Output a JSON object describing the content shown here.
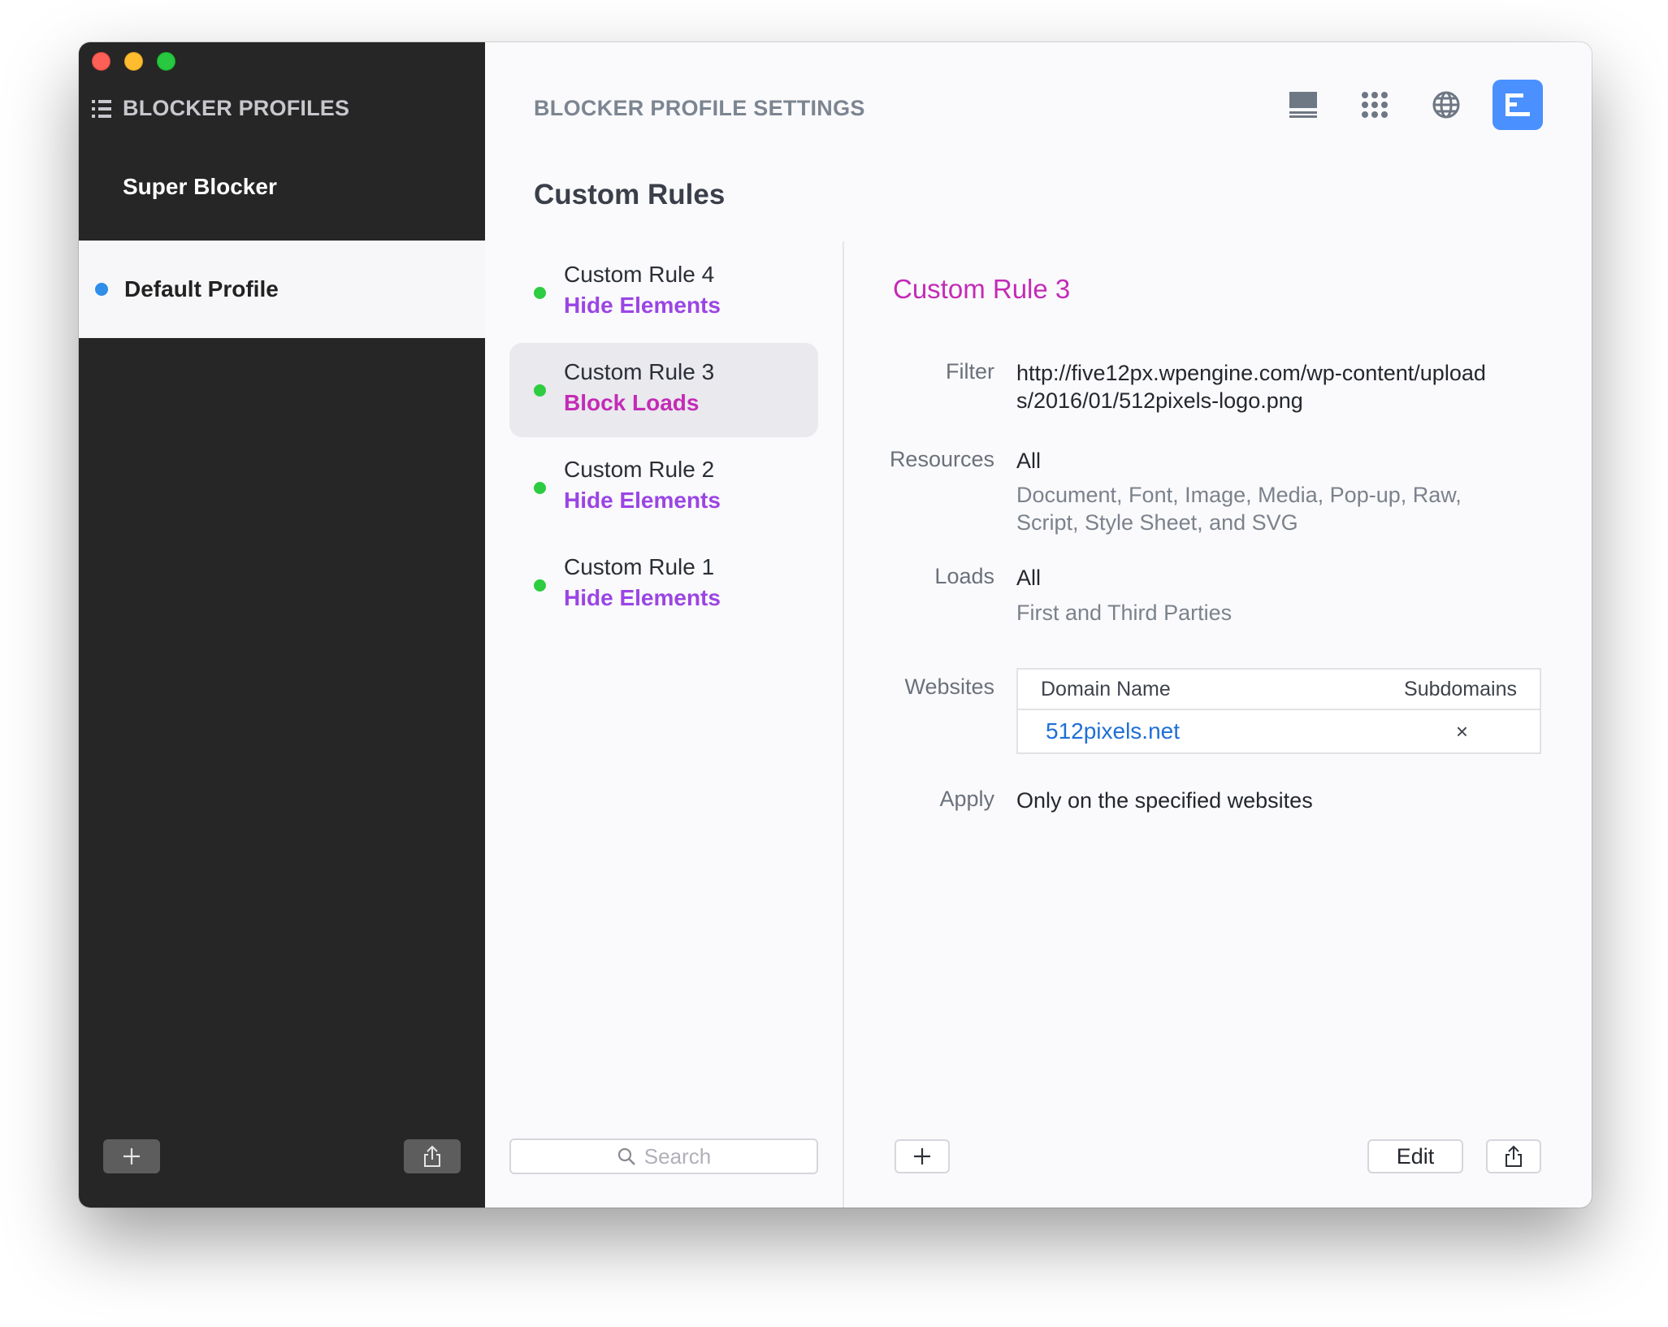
{
  "sidebar": {
    "title": "BLOCKER PROFILES",
    "profiles": [
      {
        "label": "Super Blocker"
      },
      {
        "label": "Default Profile"
      }
    ]
  },
  "main": {
    "title": "BLOCKER PROFILE SETTINGS",
    "section_title": "Custom Rules",
    "toolbar_icons": [
      "list-view-icon",
      "grid-view-icon",
      "globe-icon",
      "custom-rules-icon"
    ]
  },
  "rules": [
    {
      "name": "Custom Rule 4",
      "action": "Hide Elements"
    },
    {
      "name": "Custom Rule 3",
      "action": "Block Loads"
    },
    {
      "name": "Custom Rule 2",
      "action": "Hide Elements"
    },
    {
      "name": "Custom Rule 1",
      "action": "Hide Elements"
    }
  ],
  "search": {
    "placeholder": "Search"
  },
  "detail": {
    "title": "Custom Rule 3",
    "filter_label": "Filter",
    "filter_value_line1": "http://five12px.wpengine.com/wp-content/upload",
    "filter_value_line2": "s/2016/01/512pixels-logo.png",
    "resources_label": "Resources",
    "resources_value": "All",
    "resources_detail_line1": "Document, Font, Image, Media, Pop-up, Raw,",
    "resources_detail_line2": "Script, Style Sheet, and SVG",
    "loads_label": "Loads",
    "loads_value": "All",
    "loads_detail": "First and Third Parties",
    "websites_label": "Websites",
    "websites_columns": [
      "Domain Name",
      "Subdomains"
    ],
    "websites": [
      {
        "domain": "512pixels.net",
        "subdomains": "×"
      }
    ],
    "apply_label": "Apply",
    "apply_value": "Only on the specified websites",
    "edit_label": "Edit"
  },
  "colors": {
    "accent_blue": "#4a90ff",
    "block_magenta": "#c42bb6",
    "hide_purple": "#9b45e4",
    "status_green": "#2ecc40",
    "link_blue": "#1f6fd6"
  }
}
